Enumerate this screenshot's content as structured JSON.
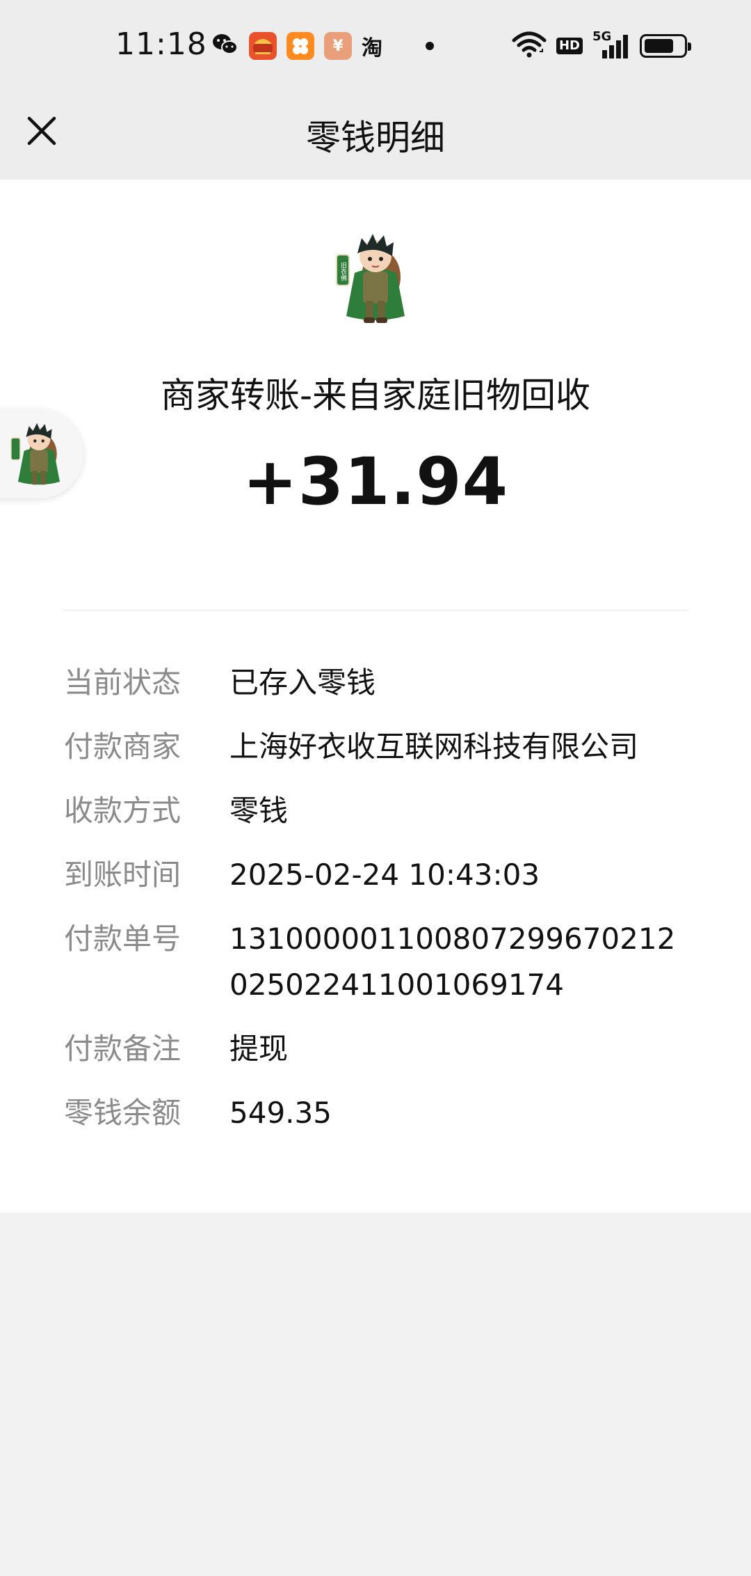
{
  "status_bar": {
    "time": "11:18",
    "network_label": "5G",
    "hd_label": "HD",
    "taobao_label": "淘",
    "app_icon_jd_label": "¥",
    "battery_level": 0.75
  },
  "nav": {
    "title": "零钱明细"
  },
  "transaction": {
    "merchant_title": "商家转账-来自家庭旧物回收",
    "amount": "+31.94"
  },
  "details": [
    {
      "label": "当前状态",
      "value": "已存入零钱"
    },
    {
      "label": "付款商家",
      "value": "上海好衣收互联网科技有限公司"
    },
    {
      "label": "收款方式",
      "value": "零钱"
    },
    {
      "label": "到账时间",
      "value": "2025-02-24 10:43:03"
    },
    {
      "label": "付款单号",
      "value": "131000001100807299670212025022411001069174"
    },
    {
      "label": "付款备注",
      "value": "提现"
    },
    {
      "label": "零钱余额",
      "value": "549.35"
    }
  ],
  "avatar_badge_text": "旧衣佛",
  "colors": {
    "header_bg": "#ededed",
    "page_bg": "#f2f2f2",
    "card_bg": "#ffffff",
    "label_gray": "#8a8a8a",
    "avatar_green": "#2e7d3a"
  }
}
